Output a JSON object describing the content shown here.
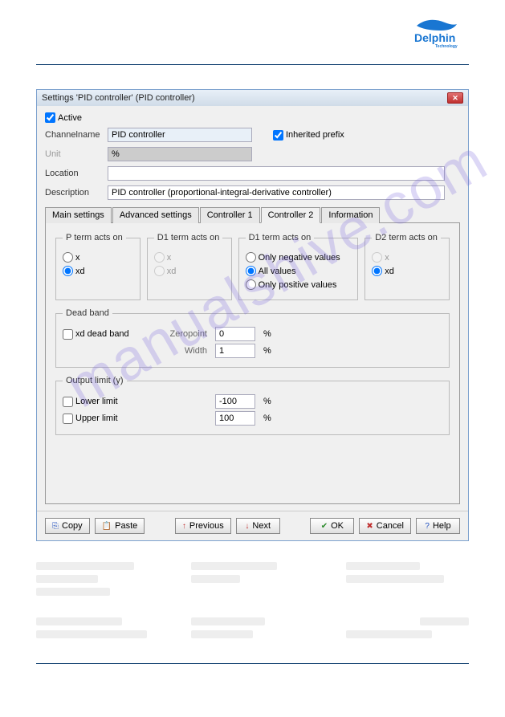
{
  "logo_text": "Delphin",
  "logo_sub": "Technology",
  "dialog": {
    "title": "Settings 'PID controller' (PID controller)",
    "active_label": "Active",
    "active_checked": true,
    "channelname_label": "Channelname",
    "channelname_value": "PID controller",
    "inherited_label": "Inherited prefix",
    "inherited_checked": true,
    "unit_label": "Unit",
    "unit_value": "%",
    "location_label": "Location",
    "location_value": "",
    "description_label": "Description",
    "description_value": "PID controller (proportional-integral-derivative controller)"
  },
  "tabs": {
    "t0": "Main settings",
    "t1": "Advanced settings",
    "t2": "Controller 1",
    "t3": "Controller 2",
    "t4": "Information"
  },
  "pterm": {
    "legend": "P term acts on",
    "x": "x",
    "xd": "xd",
    "selected": "xd"
  },
  "d1term": {
    "legend": "D1 term acts on",
    "x": "x",
    "xd": "xd"
  },
  "d1term2": {
    "legend": "D1 term acts on",
    "neg": "Only negative values",
    "all": "All values",
    "pos": "Only positive values",
    "selected": "all"
  },
  "d2term": {
    "legend": "D2 term acts on",
    "x": "x",
    "xd": "xd",
    "selected": "xd"
  },
  "deadband": {
    "legend": "Dead band",
    "xd_label": "xd dead band",
    "zeropoint_label": "Zeropoint",
    "zeropoint_value": "0",
    "width_label": "Width",
    "width_value": "1",
    "unit": "%"
  },
  "outputlimit": {
    "legend": "Output limit (y)",
    "lower_label": "Lower limit",
    "lower_value": "-100",
    "upper_label": "Upper limit",
    "upper_value": "100",
    "unit": "%"
  },
  "buttons": {
    "copy": "Copy",
    "paste": "Paste",
    "previous": "Previous",
    "next": "Next",
    "ok": "OK",
    "cancel": "Cancel",
    "help": "Help"
  },
  "watermark": "manualshive.com"
}
